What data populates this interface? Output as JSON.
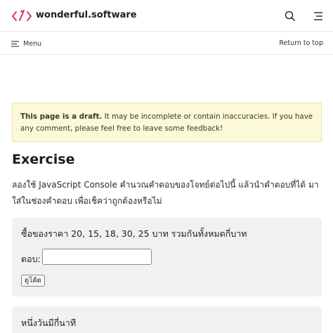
{
  "header": {
    "site_title": "wonderful.software",
    "icons": {
      "logo": "code-brackets-logo",
      "search": "search-icon",
      "menu": "hamburger-icon"
    },
    "accent_color": "#d6336c"
  },
  "subheader": {
    "menu_label": "Menu",
    "return_label": "Return to top"
  },
  "draft_notice": {
    "bold": "This page is a draft.",
    "text": " It may be incomplete or contain inaccuracies. If you have any comment, please feel free to ",
    "link": "leave some feedback",
    "end": "!",
    "bg_color": "#fcf9d8"
  },
  "exercise": {
    "title": "Exercise",
    "intro": "ลองใช้ JavaScript Console คำนวณคำตอบของโจทย์ต่อไปนี้  แล้วนำคำตอบที่ได้ มาใส่ในช่องคำตอบ  เพื่อเช็คว่าถูกต้องหรือไม่"
  },
  "questions": [
    {
      "text": "ซื้อของราคา 20, 15, 18, 30, 25 บาท รวมกันทั้งหมดกี่บาท",
      "answer_label": "ตอบ:",
      "answer_value": "",
      "check_label": "ดูโค้ด"
    },
    {
      "text": "หนึ่งวันมีกี่นาที"
    }
  ]
}
